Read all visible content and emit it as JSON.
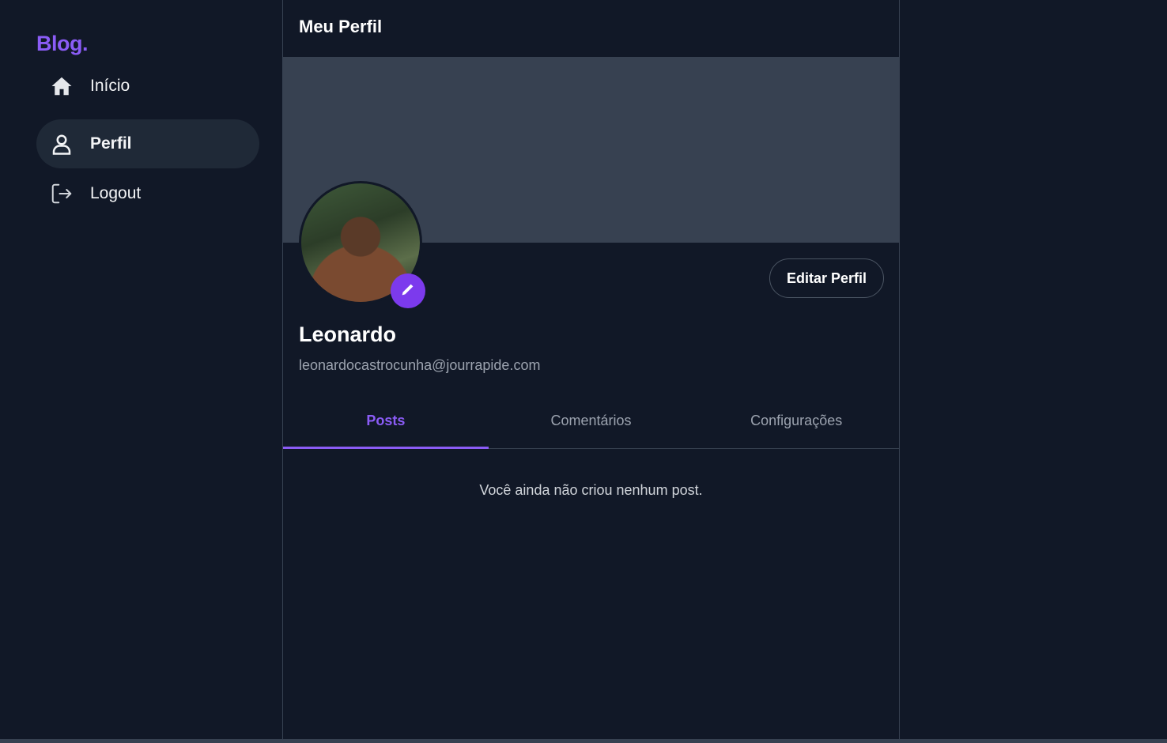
{
  "sidebar": {
    "logo": "Blog.",
    "items": [
      {
        "label": "Início",
        "icon": "home-icon",
        "active": false
      },
      {
        "label": "Perfil",
        "icon": "user-icon",
        "active": true
      },
      {
        "label": "Logout",
        "icon": "logout-icon",
        "active": false
      }
    ]
  },
  "header": {
    "title": "Meu Perfil"
  },
  "profile": {
    "name": "Leonardo",
    "email": "leonardocastrocunha@jourrapide.com",
    "edit_button_label": "Editar Perfil",
    "avatar_edit_icon": "pencil-icon"
  },
  "tabs": [
    {
      "label": "Posts",
      "active": true
    },
    {
      "label": "Comentários",
      "active": false
    },
    {
      "label": "Configurações",
      "active": false
    }
  ],
  "content": {
    "empty_message": "Você ainda não criou nenhum post."
  },
  "colors": {
    "background": "#111827",
    "accent": "#8b5cf6",
    "banner": "#374151",
    "active_nav": "#1f2937"
  }
}
